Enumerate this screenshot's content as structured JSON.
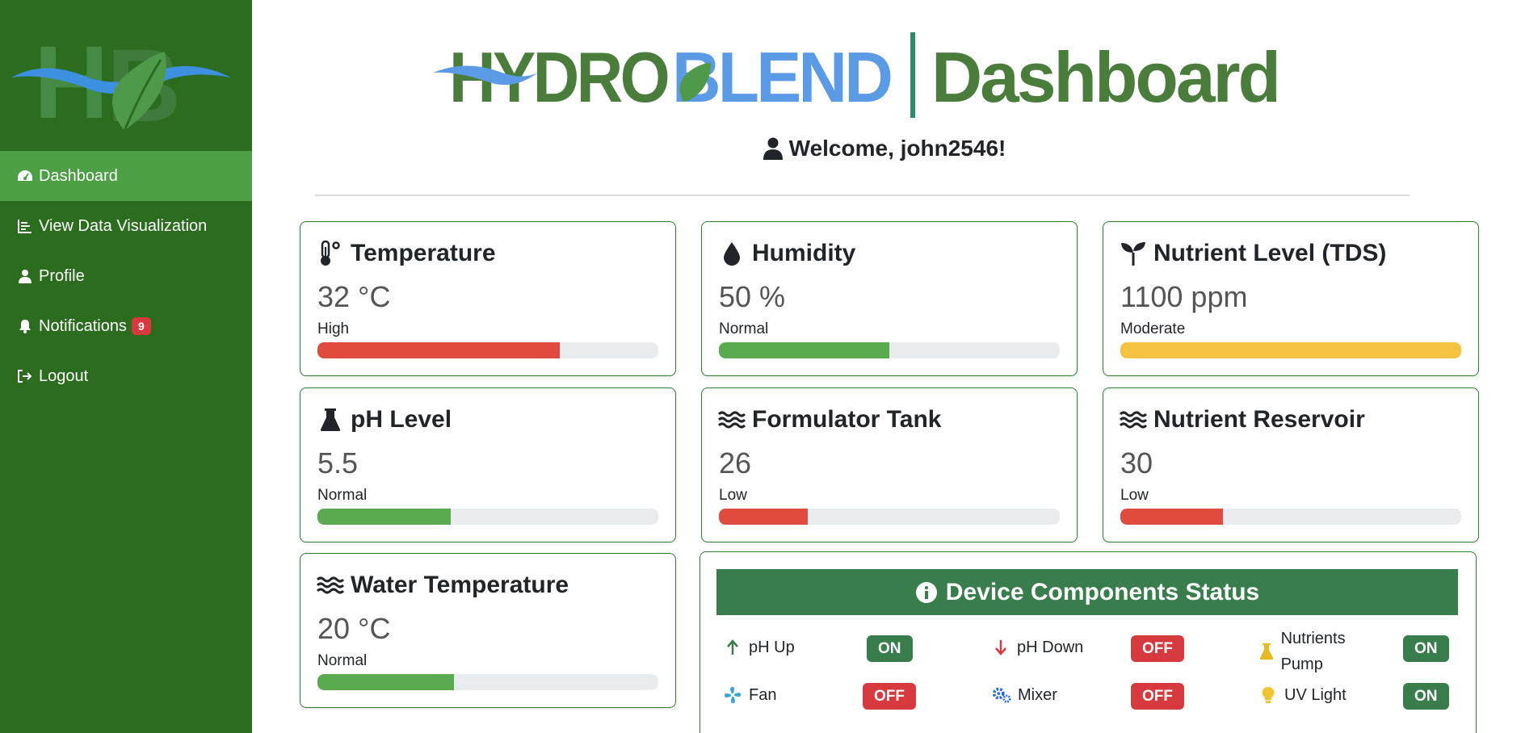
{
  "sidebar": {
    "logo_text": "HB",
    "items": [
      {
        "label": "Dashboard",
        "icon": "gauge-icon",
        "active": true
      },
      {
        "label": "View Data Visualization",
        "icon": "chart-bars-icon"
      },
      {
        "label": "Profile",
        "icon": "user-icon"
      },
      {
        "label": "Notifications",
        "icon": "bell-icon",
        "badge": "9"
      },
      {
        "label": "Logout",
        "icon": "logout-icon"
      }
    ]
  },
  "header": {
    "brand_hydro": "HYDRO",
    "brand_blend": "BLEND",
    "brand_dashboard": "Dashboard",
    "welcome": "Welcome, john2546!"
  },
  "cards": [
    {
      "title": "Temperature",
      "value": "32 °C",
      "status": "High",
      "level": 0.71,
      "color": "#e04b3f",
      "icon": "thermometer-icon"
    },
    {
      "title": "Humidity",
      "value": "50 %",
      "status": "Normal",
      "level": 0.5,
      "color": "#5aab4f",
      "icon": "droplet-icon"
    },
    {
      "title": "Nutrient Level (TDS)",
      "value": "1100 ppm",
      "status": "Moderate",
      "level": 1.0,
      "color": "#f5c242",
      "icon": "seedling-icon"
    },
    {
      "title": "pH Level",
      "value": "5.5",
      "status": "Normal",
      "level": 0.39,
      "color": "#5aab4f",
      "icon": "flask-icon"
    },
    {
      "title": "Formulator Tank",
      "value": "26",
      "status": "Low",
      "level": 0.26,
      "color": "#e04b3f",
      "icon": "water-icon"
    },
    {
      "title": "Nutrient Reservoir",
      "value": "30",
      "status": "Low",
      "level": 0.3,
      "color": "#e04b3f",
      "icon": "water-icon"
    },
    {
      "title": "Water Temperature",
      "value": "20 °C",
      "status": "Normal",
      "level": 0.4,
      "color": "#5aab4f",
      "icon": "water-icon"
    }
  ],
  "devices": {
    "title": "Device Components Status",
    "items": [
      {
        "label": "pH Up",
        "state": "ON",
        "icon": "arrow-up-icon"
      },
      {
        "label": "pH Down",
        "state": "OFF",
        "icon": "arrow-down-icon"
      },
      {
        "label": "Nutrients Pump",
        "state": "ON",
        "icon": "flask-icon"
      },
      {
        "label": "Fan",
        "state": "OFF",
        "icon": "fan-icon"
      },
      {
        "label": "Mixer",
        "state": "OFF",
        "icon": "gears-icon"
      },
      {
        "label": "UV Light",
        "state": "ON",
        "icon": "lightbulb-icon"
      }
    ]
  },
  "colors": {
    "sidebar_bg": "#2b6c1f",
    "sidebar_active": "#4c9f44",
    "brand_green": "#4a7d3c",
    "brand_blue": "#5b9be6",
    "on": "#3a7d4c",
    "off": "#d63a3f"
  }
}
